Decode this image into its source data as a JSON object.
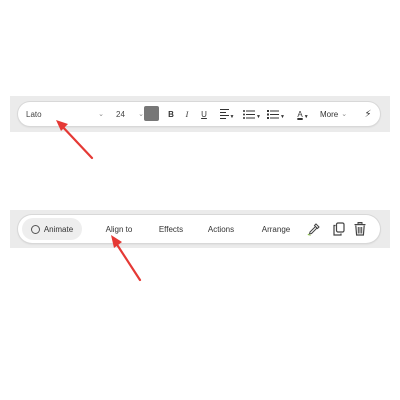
{
  "text_toolbar": {
    "font": "Lato",
    "font_size": "24",
    "bold": "B",
    "italic": "I",
    "underline": "U",
    "text_color": "A",
    "more": "More"
  },
  "action_toolbar": {
    "animate": "Animate",
    "align_to": "Align to",
    "effects": "Effects",
    "actions": "Actions",
    "arrange": "Arrange"
  },
  "colors": {
    "swatch": "#777777",
    "arrow": "#e53935",
    "band": "#ebebeb"
  }
}
